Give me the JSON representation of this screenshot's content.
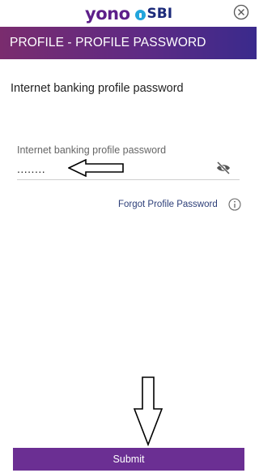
{
  "brand": {
    "primary": "yono",
    "secondary": "SBI"
  },
  "header": {
    "title": "PROFILE - PROFILE PASSWORD"
  },
  "section": {
    "title": "Internet banking profile password"
  },
  "password_field": {
    "label": "Internet banking profile password",
    "value": "........"
  },
  "forgot_link": "Forgot Profile Password",
  "submit_label": "Submit",
  "colors": {
    "header_start": "#7a2c6e",
    "header_end": "#3a2a8c",
    "button": "#6b2f93",
    "link": "#2c3e78"
  },
  "icons": [
    "close-icon",
    "eye-slash-icon",
    "info-icon"
  ]
}
